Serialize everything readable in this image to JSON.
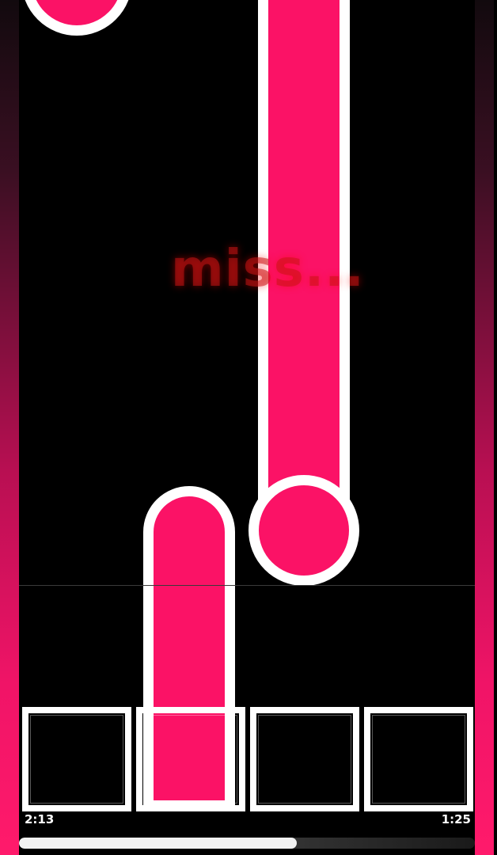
{
  "colors": {
    "note_fill": "#fb1266",
    "note_outline": "#ffffff",
    "background": "#000000",
    "miss_text": "#c81414",
    "side_gradient_bottom": "#ff1a6b"
  },
  "judgement": {
    "text": "miss..."
  },
  "lanes": {
    "count": 4,
    "pressed": [
      false,
      false,
      false,
      false
    ]
  },
  "time": {
    "elapsed": "2:13",
    "remaining": "1:25"
  },
  "progress": {
    "fraction": 0.61
  }
}
